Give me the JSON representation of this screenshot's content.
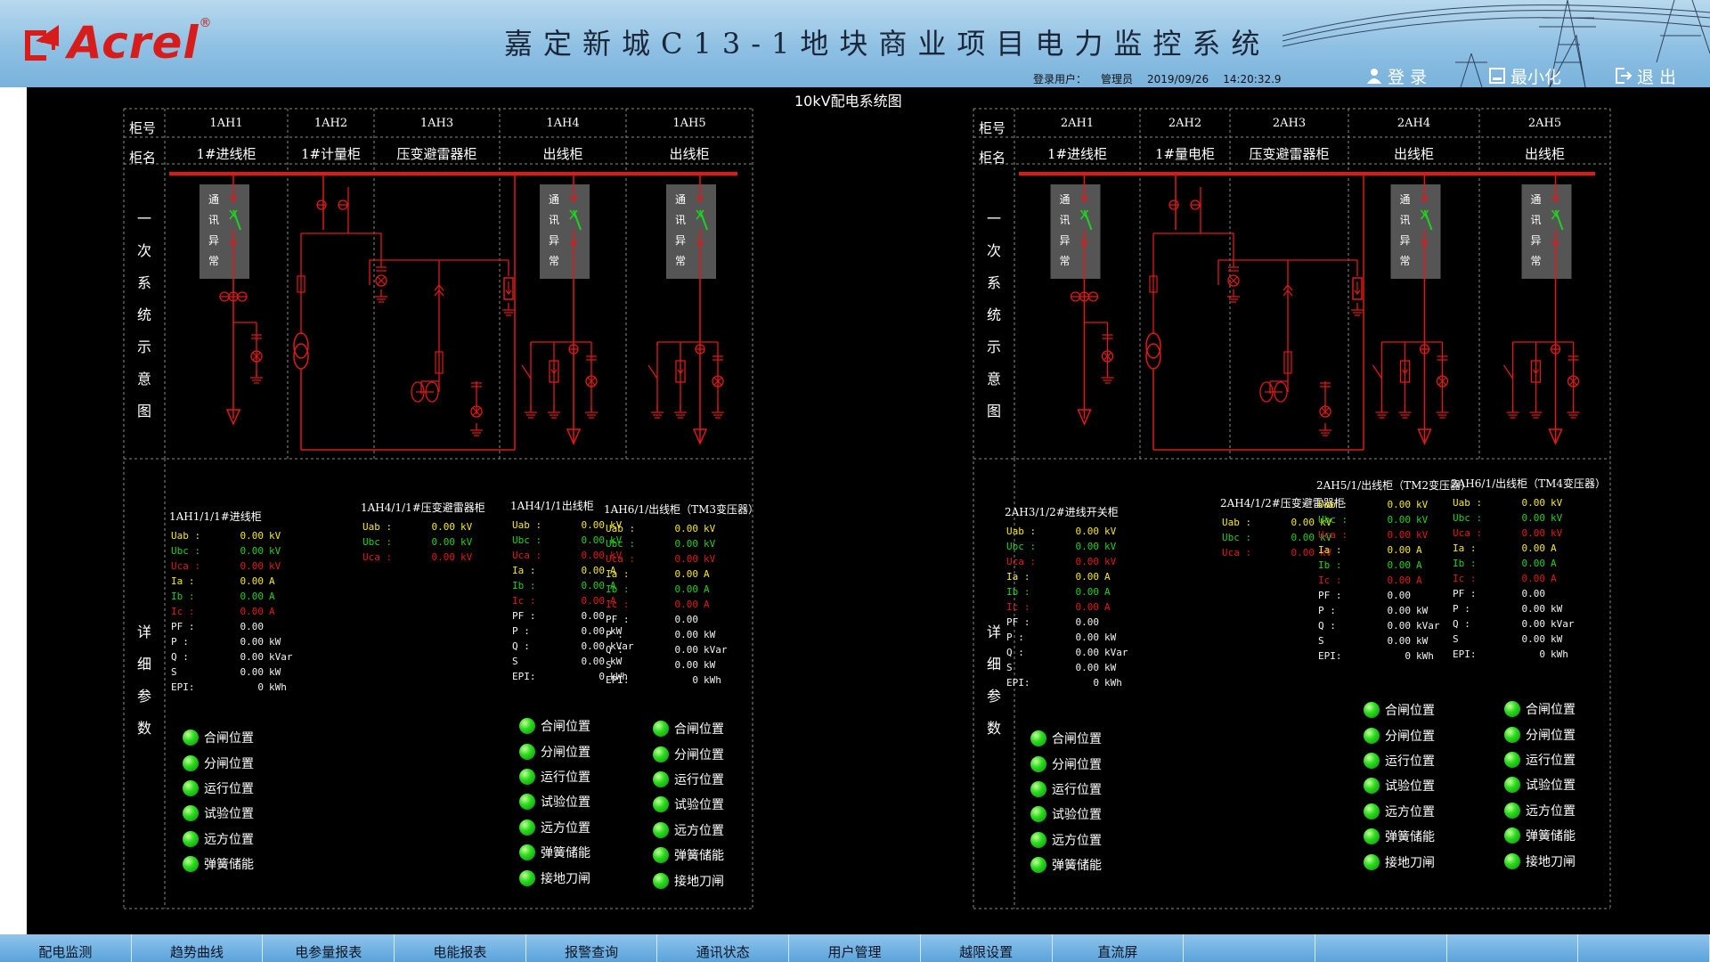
{
  "header": {
    "brand": "Acrel",
    "brand_mark": "®",
    "title": "嘉定新城C13-1地块商业项目电力监控系统",
    "login_label": "登录用户：",
    "user": "管理员",
    "date": "2019/09/26",
    "time": "14:20:32.9",
    "buttons": {
      "login": "登 录",
      "minimize": "最小化",
      "exit": "退 出"
    }
  },
  "diagram_title": "10kV配电系统图",
  "row_labels": {
    "cabinet_no": "柜号",
    "cabinet_name": "柜名",
    "primary": "一次系统示意图",
    "details": "详细参数"
  },
  "comm_fault": "通讯异常",
  "left": {
    "cabinets": [
      {
        "no": "1AH1",
        "name": "1#进线柜"
      },
      {
        "no": "1AH2",
        "name": "1#计量柜"
      },
      {
        "no": "1AH3",
        "name": "压变避雷器柜"
      },
      {
        "no": "1AH4",
        "name": "出线柜"
      },
      {
        "no": "1AH5",
        "name": "出线柜"
      }
    ],
    "panels": [
      {
        "title": "1AH1/1/1#进线柜",
        "params": [
          {
            "k": "Uab :",
            "v": "0.00",
            "u": "kV",
            "c": "y"
          },
          {
            "k": "Ubc :",
            "v": "0.00",
            "u": "kV",
            "c": "g"
          },
          {
            "k": "Uca :",
            "v": "0.00",
            "u": "kV",
            "c": "r"
          },
          {
            "k": "Ia  :",
            "v": "0.00",
            "u": "A",
            "c": "y"
          },
          {
            "k": "Ib  :",
            "v": "0.00",
            "u": "A",
            "c": "g"
          },
          {
            "k": "Ic  :",
            "v": "0.00",
            "u": "A",
            "c": "r"
          },
          {
            "k": "PF  :",
            "v": "0.00",
            "u": "",
            "c": "w"
          },
          {
            "k": "P   :",
            "v": "0.00",
            "u": "kW",
            "c": "w"
          },
          {
            "k": "Q   :",
            "v": "0.00",
            "u": "kVar",
            "c": "w"
          },
          {
            "k": "S",
            "v": "0.00",
            "u": "kW",
            "c": "w"
          },
          {
            "k": "EPI:",
            "v": "0",
            "u": "kWh",
            "c": "w"
          }
        ],
        "status": [
          "合闸位置",
          "分闸位置",
          "运行位置",
          "试验位置",
          "远方位置",
          "弹簧储能"
        ]
      },
      {
        "title": "1AH4/1/1#压变避雷器柜",
        "params": [
          {
            "k": "Uab :",
            "v": "0.00",
            "u": "kV",
            "c": "y"
          },
          {
            "k": "Ubc :",
            "v": "0.00",
            "u": "kV",
            "c": "g"
          },
          {
            "k": "Uca :",
            "v": "0.00",
            "u": "kV",
            "c": "r"
          }
        ],
        "status": []
      },
      {
        "title": "1AH4/1/1出线柜",
        "params": [
          {
            "k": "Uab :",
            "v": "0.00",
            "u": "kV",
            "c": "y"
          },
          {
            "k": "Ubc :",
            "v": "0.00",
            "u": "kV",
            "c": "g"
          },
          {
            "k": "Uca :",
            "v": "0.00",
            "u": "kV",
            "c": "r"
          },
          {
            "k": "Ia  :",
            "v": "0.00",
            "u": "A",
            "c": "y"
          },
          {
            "k": "Ib  :",
            "v": "0.00",
            "u": "A",
            "c": "g"
          },
          {
            "k": "Ic  :",
            "v": "0.00",
            "u": "A",
            "c": "r"
          },
          {
            "k": "PF  :",
            "v": "0.00",
            "u": "",
            "c": "w"
          },
          {
            "k": "P   :",
            "v": "0.00",
            "u": "kW",
            "c": "w"
          },
          {
            "k": "Q   :",
            "v": "0.00",
            "u": "kVar",
            "c": "w"
          },
          {
            "k": "S",
            "v": "0.00",
            "u": "kW",
            "c": "w"
          },
          {
            "k": "EPI:",
            "v": "0",
            "u": "kWh",
            "c": "w"
          }
        ],
        "status": [
          "合闸位置",
          "分闸位置",
          "运行位置",
          "试验位置",
          "远方位置",
          "弹簧储能",
          "接地刀闸"
        ]
      },
      {
        "title": "1AH6/1/出线柜（TM3变压器）",
        "params": [
          {
            "k": "Uab :",
            "v": "0.00",
            "u": "kV",
            "c": "y"
          },
          {
            "k": "Ubc :",
            "v": "0.00",
            "u": "kV",
            "c": "g"
          },
          {
            "k": "Uca :",
            "v": "0.00",
            "u": "kV",
            "c": "r"
          },
          {
            "k": "Ia  :",
            "v": "0.00",
            "u": "A",
            "c": "y"
          },
          {
            "k": "Ib  :",
            "v": "0.00",
            "u": "A",
            "c": "g"
          },
          {
            "k": "Ic  :",
            "v": "0.00",
            "u": "A",
            "c": "r"
          },
          {
            "k": "PF  :",
            "v": "0.00",
            "u": "",
            "c": "w"
          },
          {
            "k": "P   :",
            "v": "0.00",
            "u": "kW",
            "c": "w"
          },
          {
            "k": "Q   :",
            "v": "0.00",
            "u": "kVar",
            "c": "w"
          },
          {
            "k": "S",
            "v": "0.00",
            "u": "kW",
            "c": "w"
          },
          {
            "k": "EPI:",
            "v": "0",
            "u": "kWh",
            "c": "w"
          }
        ],
        "status": [
          "合闸位置",
          "分闸位置",
          "运行位置",
          "试验位置",
          "远方位置",
          "弹簧储能",
          "接地刀闸"
        ]
      }
    ]
  },
  "right": {
    "cabinets": [
      {
        "no": "2AH1",
        "name": "1#进线柜"
      },
      {
        "no": "2AH2",
        "name": "1#量电柜"
      },
      {
        "no": "2AH3",
        "name": "压变避雷器柜"
      },
      {
        "no": "2AH4",
        "name": "出线柜"
      },
      {
        "no": "2AH5",
        "name": "出线柜"
      }
    ],
    "panels": [
      {
        "title": "2AH3/1/2#进线开关柜",
        "params": [
          {
            "k": "Uab :",
            "v": "0.00",
            "u": "kV",
            "c": "y"
          },
          {
            "k": "Ubc :",
            "v": "0.00",
            "u": "kV",
            "c": "g"
          },
          {
            "k": "Uca :",
            "v": "0.00",
            "u": "kV",
            "c": "r"
          },
          {
            "k": "Ia  :",
            "v": "0.00",
            "u": "A",
            "c": "y"
          },
          {
            "k": "Ib  :",
            "v": "0.00",
            "u": "A",
            "c": "g"
          },
          {
            "k": "Ic  :",
            "v": "0.00",
            "u": "A",
            "c": "r"
          },
          {
            "k": "PF  :",
            "v": "0.00",
            "u": "",
            "c": "w"
          },
          {
            "k": "P   :",
            "v": "0.00",
            "u": "kW",
            "c": "w"
          },
          {
            "k": "Q   :",
            "v": "0.00",
            "u": "kVar",
            "c": "w"
          },
          {
            "k": "S",
            "v": "0.00",
            "u": "kW",
            "c": "w"
          },
          {
            "k": "EPI:",
            "v": "0",
            "u": "kWh",
            "c": "w"
          }
        ],
        "status": [
          "合闸位置",
          "分闸位置",
          "运行位置",
          "试验位置",
          "远方位置",
          "弹簧储能"
        ]
      },
      {
        "title": "2AH4/1/2#压变避雷器柜",
        "params": [
          {
            "k": "Uab :",
            "v": "0.00",
            "u": "kV",
            "c": "y"
          },
          {
            "k": "Ubc :",
            "v": "0.00",
            "u": "kV",
            "c": "g"
          },
          {
            "k": "Uca :",
            "v": "0.00",
            "u": "kV",
            "c": "r"
          }
        ],
        "status": []
      },
      {
        "title": "2AH5/1/出线柜（TM2变压器）",
        "params": [
          {
            "k": "Uab :",
            "v": "0.00",
            "u": "kV",
            "c": "y"
          },
          {
            "k": "Ubc :",
            "v": "0.00",
            "u": "kV",
            "c": "g"
          },
          {
            "k": "Uca :",
            "v": "0.00",
            "u": "kV",
            "c": "r"
          },
          {
            "k": "Ia  :",
            "v": "0.00",
            "u": "A",
            "c": "y"
          },
          {
            "k": "Ib  :",
            "v": "0.00",
            "u": "A",
            "c": "g"
          },
          {
            "k": "Ic  :",
            "v": "0.00",
            "u": "A",
            "c": "r"
          },
          {
            "k": "PF  :",
            "v": "0.00",
            "u": "",
            "c": "w"
          },
          {
            "k": "P   :",
            "v": "0.00",
            "u": "kW",
            "c": "w"
          },
          {
            "k": "Q   :",
            "v": "0.00",
            "u": "kVar",
            "c": "w"
          },
          {
            "k": "S",
            "v": "0.00",
            "u": "kW",
            "c": "w"
          },
          {
            "k": "EPI:",
            "v": "0",
            "u": "kWh",
            "c": "w"
          }
        ],
        "status": [
          "合闸位置",
          "分闸位置",
          "运行位置",
          "试验位置",
          "远方位置",
          "弹簧储能",
          "接地刀闸"
        ]
      },
      {
        "title": "2AH6/1/出线柜（TM4变压器）",
        "params": [
          {
            "k": "Uab :",
            "v": "0.00",
            "u": "kV",
            "c": "y"
          },
          {
            "k": "Ubc :",
            "v": "0.00",
            "u": "kV",
            "c": "g"
          },
          {
            "k": "Uca :",
            "v": "0.00",
            "u": "kV",
            "c": "r"
          },
          {
            "k": "Ia  :",
            "v": "0.00",
            "u": "A",
            "c": "y"
          },
          {
            "k": "Ib  :",
            "v": "0.00",
            "u": "A",
            "c": "g"
          },
          {
            "k": "Ic  :",
            "v": "0.00",
            "u": "A",
            "c": "r"
          },
          {
            "k": "PF  :",
            "v": "0.00",
            "u": "",
            "c": "w"
          },
          {
            "k": "P   :",
            "v": "0.00",
            "u": "kW",
            "c": "w"
          },
          {
            "k": "Q   :",
            "v": "0.00",
            "u": "kVar",
            "c": "w"
          },
          {
            "k": "S",
            "v": "0.00",
            "u": "kW",
            "c": "w"
          },
          {
            "k": "EPI:",
            "v": "0",
            "u": "kWh",
            "c": "w"
          }
        ],
        "status": [
          "合闸位置",
          "分闸位置",
          "运行位置",
          "试验位置",
          "远方位置",
          "弹簧储能",
          "接地刀闸"
        ]
      }
    ]
  },
  "nav": [
    "配电监测",
    "趋势曲线",
    "电参量报表",
    "电能报表",
    "报警查询",
    "通讯状态",
    "用户管理",
    "越限设置",
    "直流屏",
    "",
    "",
    "",
    ""
  ],
  "colors": {
    "bus": "#e01818",
    "breaker_closed": "#1fd11f",
    "comm_box": "#555555",
    "led": "#2bdc1f",
    "grid": "#8a8a8a"
  }
}
